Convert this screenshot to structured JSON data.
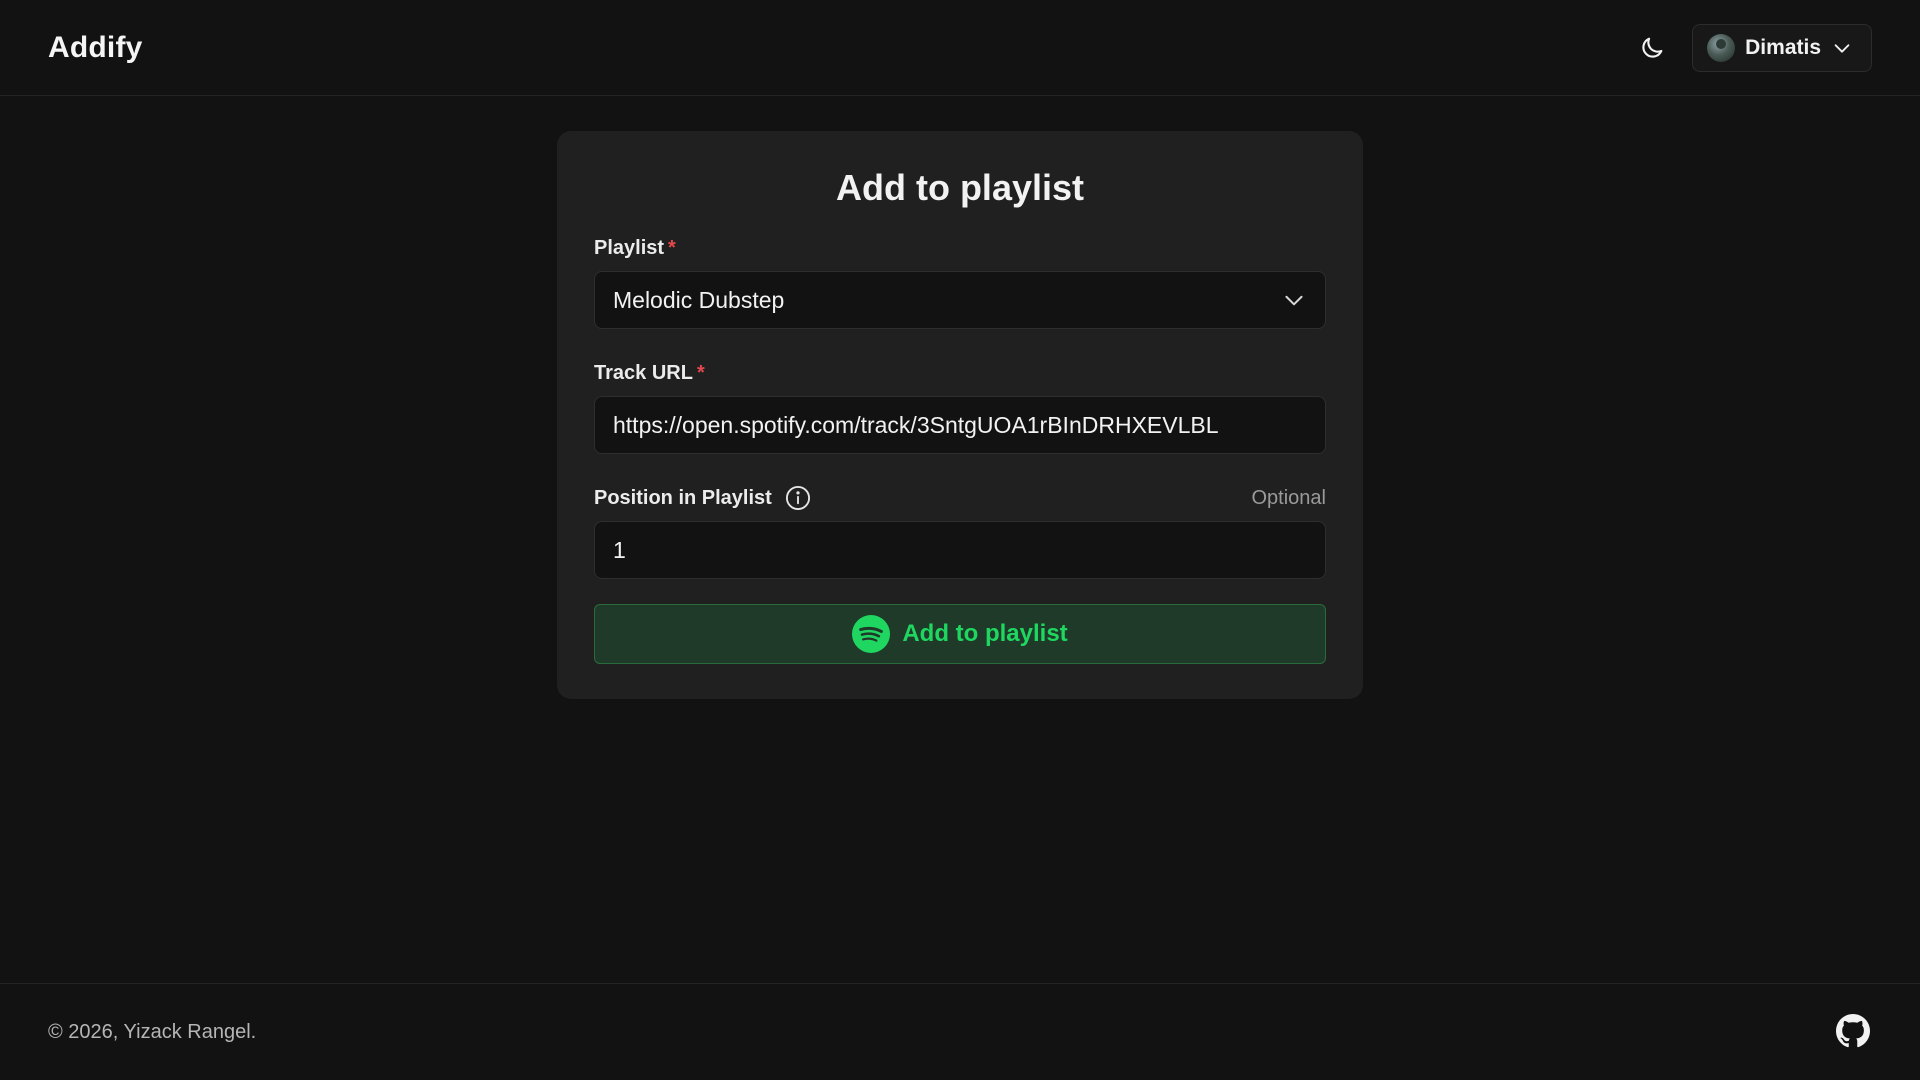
{
  "app": {
    "title": "Addify"
  },
  "header": {
    "theme_icon": "moon-icon",
    "user": {
      "name": "Dimatis",
      "menu_icon": "chevron-down-icon"
    }
  },
  "form": {
    "title": "Add to playlist",
    "playlist": {
      "label": "Playlist",
      "required_mark": "*",
      "value": "Melodic Dubstep"
    },
    "track_url": {
      "label": "Track URL",
      "required_mark": "*",
      "value": "https://open.spotify.com/track/3SntgUOA1rBInDRHXEVLBL"
    },
    "position": {
      "label": "Position in Playlist",
      "optional_label": "Optional",
      "value": "1",
      "info_icon": "info-icon"
    },
    "submit": {
      "label": "Add to playlist",
      "icon": "spotify-icon"
    }
  },
  "footer": {
    "copyright": "© 2026, Yizack Rangel.",
    "icon": "github-icon"
  },
  "colors": {
    "background": "#121212",
    "card": "#202020",
    "accent": "#1fd760",
    "required": "#e5484d"
  }
}
